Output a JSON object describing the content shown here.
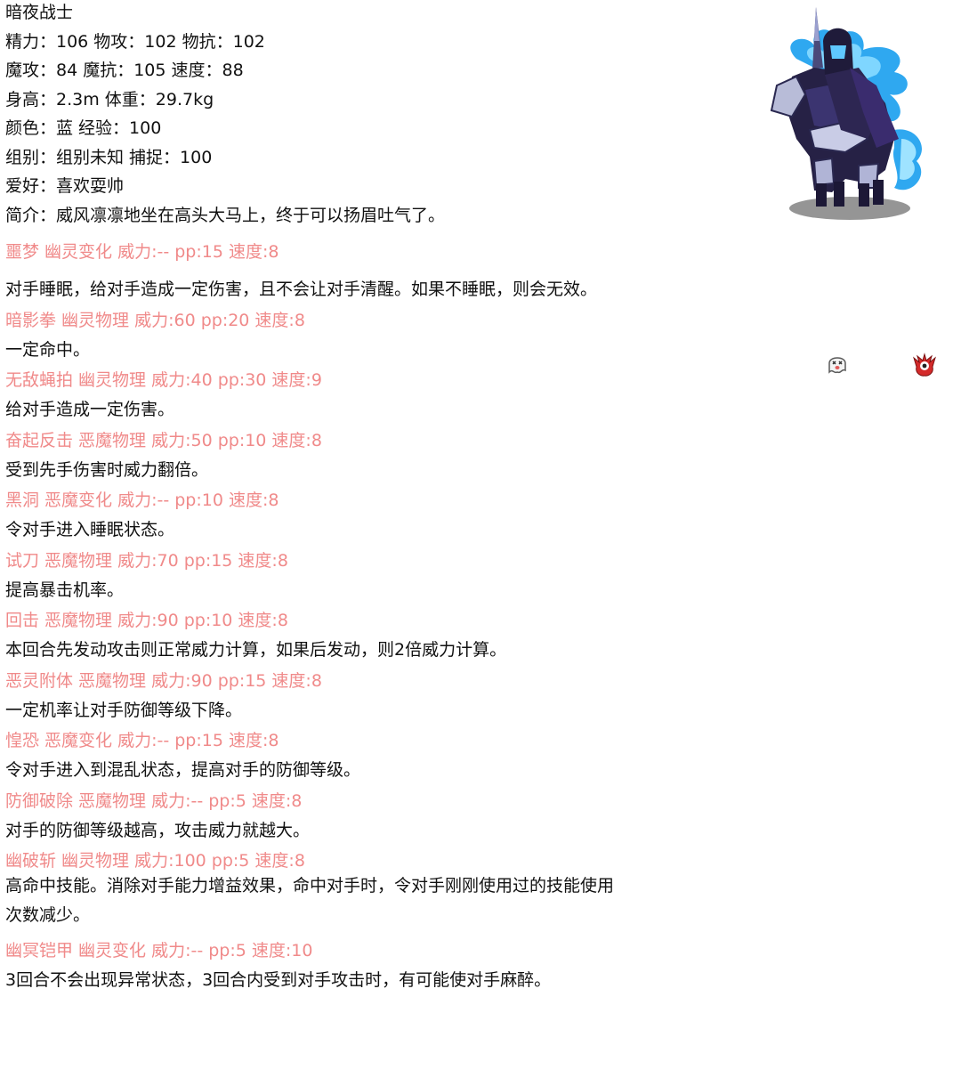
{
  "pet": {
    "name": "暗夜战士",
    "stats_line1": "精力：106 物攻：102 物抗：102",
    "stats_line2": "魔攻：84 魔抗：105 速度：88",
    "stats_line3": "身高：2.3m 体重：29.7kg",
    "stats_line4": "颜色：蓝 经验：100",
    "stats_line5": "组别：组别未知 捕捉：100",
    "hobby": "爱好：喜欢耍帅",
    "intro": "简介：威风凛凛地坐在高头大马上，终于可以扬眉吐气了。"
  },
  "icons": {
    "pet_image": "dark-knight-on-horse-image",
    "type1": "ghost-type-icon",
    "type2": "demon-type-icon",
    "skill_color": "#f08a8a",
    "text_color": "#111111"
  },
  "skills": [
    {
      "header": "噩梦 幽灵变化 威力:-- pp:15 速度:8",
      "desc": "对手睡眠，给对手造成一定伤害，且不会让对手清醒。如果不睡眠，则会无效。"
    },
    {
      "header": "暗影拳 幽灵物理 威力:60 pp:20 速度:8",
      "desc": "一定命中。"
    },
    {
      "header": "无敌蝇拍 幽灵物理 威力:40 pp:30 速度:9",
      "desc": "给对手造成一定伤害。"
    },
    {
      "header": "奋起反击 恶魔物理 威力:50 pp:10 速度:8",
      "desc": "受到先手伤害时威力翻倍。"
    },
    {
      "header": "黑洞 恶魔变化 威力:-- pp:10 速度:8",
      "desc": "令对手进入睡眠状态。"
    },
    {
      "header": "试刀 恶魔物理 威力:70 pp:15 速度:8",
      "desc": "提高暴击机率。"
    },
    {
      "header": "回击 恶魔物理 威力:90 pp:10 速度:8",
      "desc": "本回合先发动攻击则正常威力计算，如果后发动，则2倍威力计算。"
    },
    {
      "header": "恶灵附体 恶魔物理 威力:90 pp:15 速度:8",
      "desc": "一定机率让对手防御等级下降。"
    },
    {
      "header": "惶恐 恶魔变化 威力:-- pp:15 速度:8",
      "desc": "令对手进入到混乱状态，提高对手的防御等级。"
    },
    {
      "header": "防御破除 恶魔物理 威力:-- pp:5 速度:8",
      "desc": "对手的防御等级越高，攻击威力就越大。"
    },
    {
      "header": "幽破斩 幽灵物理 威力:100 pp:5 速度:8",
      "desc": "高命中技能。消除对手能力增益效果，命中对手时，令对手刚刚使用过的技能使用次数减少。"
    },
    {
      "header": "幽冥铠甲 幽灵变化 威力:-- pp:5 速度:10",
      "desc": "3回合不会出现异常状态，3回合内受到对手攻击时，有可能使对手麻醉。"
    }
  ]
}
